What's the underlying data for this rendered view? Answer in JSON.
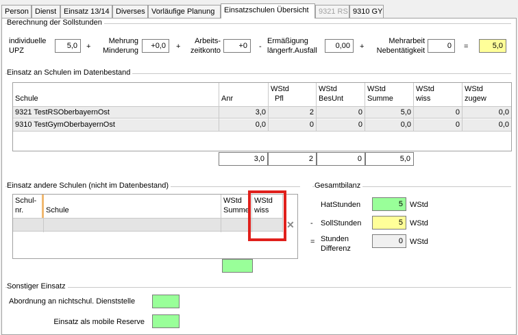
{
  "tabs": [
    {
      "label": "Person"
    },
    {
      "label": "Dienst"
    },
    {
      "label": "Einsatz 13/14"
    },
    {
      "label": "Diverses"
    },
    {
      "label": "Vorläufige Planung"
    },
    {
      "label": "Einsatzschulen Übersicht"
    },
    {
      "label": "9321 RS"
    },
    {
      "label": "9310 GY"
    }
  ],
  "soll": {
    "title": "Berechnung der Sollstunden",
    "upz_label_1": "individuelle",
    "upz_label_2": "UPZ",
    "upz_value": "5,0",
    "plus1": "+",
    "mehrung_1": "Mehrung",
    "mehrung_2": "Minderung",
    "mehrung_value": "+0,0",
    "plus2": "+",
    "konto_1": "Arbeits-",
    "konto_2": "zeitkonto",
    "konto_value": "+0",
    "minus": "-",
    "erm_1": "Ermäßigung",
    "erm_2": "längerfr.Ausfall",
    "erm_value": "0,00",
    "plus3": "+",
    "mehrarbeit_1": "Mehrarbeit",
    "mehrarbeit_2": "Nebentätigkeit",
    "mehrarbeit_value": "0",
    "equals": "=",
    "result_value": "5,0"
  },
  "einsatz_db": {
    "title": "Einsatz an Schulen im Datenbestand",
    "headers": [
      {
        "l1": "Schule",
        "l2": ""
      },
      {
        "l1": "Anr",
        "l2": ""
      },
      {
        "l1": "WStd",
        "l2": "Pfl"
      },
      {
        "l1": "WStd",
        "l2": "BesUnt"
      },
      {
        "l1": "WStd",
        "l2": "Summe"
      },
      {
        "l1": "WStd",
        "l2": "wiss"
      },
      {
        "l1": "WStd",
        "l2": "zugew"
      }
    ],
    "rows": [
      {
        "schule": "9321 TestRSOberbayernOst",
        "anr": "3,0",
        "pfl": "2",
        "besunt": "0",
        "summe": "5,0",
        "wiss": "0",
        "zugew": "0,0"
      },
      {
        "schule": "9310 TestGymOberbayernOst",
        "anr": "0,0",
        "pfl": "0",
        "besunt": "0",
        "summe": "0,0",
        "wiss": "0",
        "zugew": "0,0"
      }
    ],
    "totals": {
      "anr": "3,0",
      "pfl": "2",
      "besunt": "0",
      "summe": "5,0"
    }
  },
  "einsatz_andere": {
    "title": "Einsatz andere Schulen (nicht im Datenbestand)",
    "headers": [
      {
        "l1": "Schul-",
        "l2": "nr."
      },
      {
        "l1": "Schule",
        "l2": ""
      },
      {
        "l1": "WStd",
        "l2": "Summe"
      },
      {
        "l1": "WStd",
        "l2": "wiss"
      }
    ]
  },
  "bilanz": {
    "title": "Gesamtbilanz",
    "hat_label": "HatStunden",
    "hat_value": "5",
    "hat_unit": "WStd",
    "minus": "-",
    "soll_label": "SollStunden",
    "soll_value": "5",
    "soll_unit": "WStd",
    "equals": "=",
    "diff_label_1": "Stunden",
    "diff_label_2": "Differenz",
    "diff_value": "0",
    "diff_unit": "WStd"
  },
  "sonstiger": {
    "title": "Sonstiger Einsatz",
    "abordnung_label": "Abordnung an nichtschul. Dienststelle",
    "reserve_label": "Einsatz als mobile Reserve"
  },
  "colors": {
    "yellow": "#ffff99",
    "green": "#99ff99",
    "highlight": "#e0201c"
  }
}
